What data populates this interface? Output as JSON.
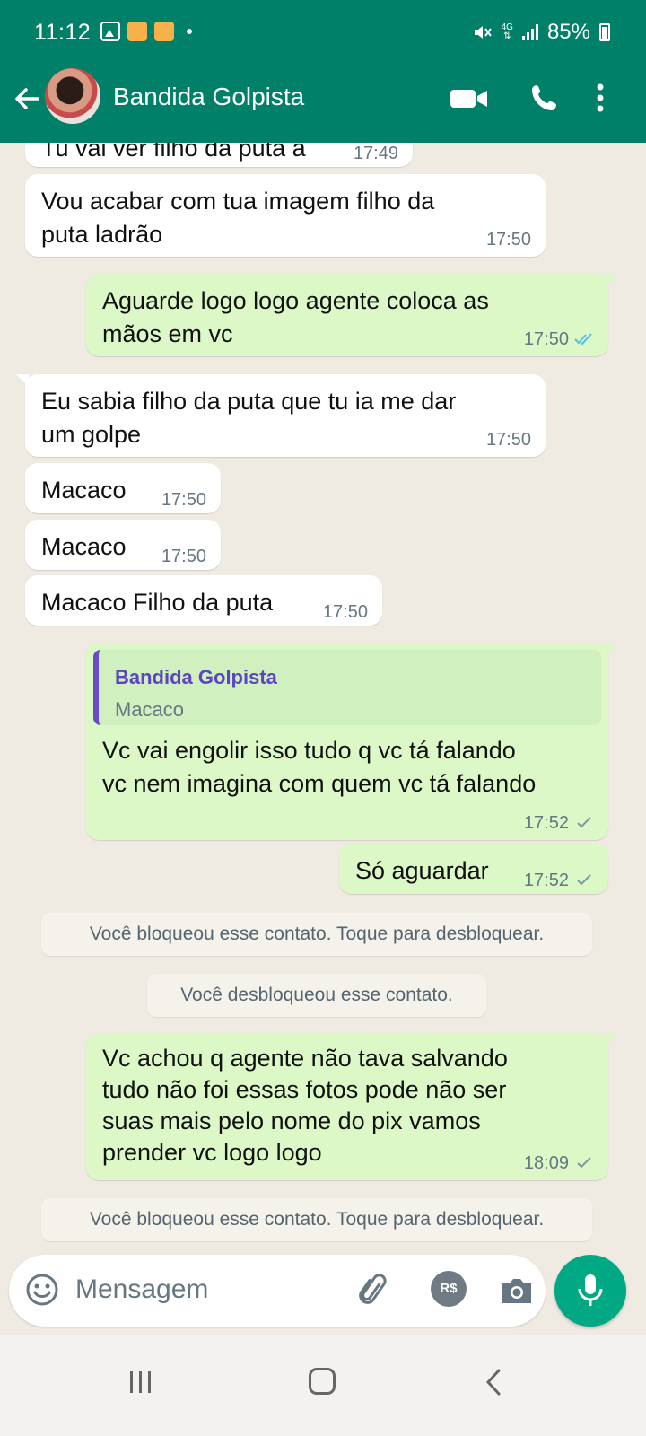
{
  "status_bar": {
    "time": "11:12",
    "network": "4G",
    "battery": "85%"
  },
  "header": {
    "contact_name": "Bandida Golpista"
  },
  "messages": [
    {
      "text": "Tu vai ver filho da puta a",
      "time": "17:49"
    },
    {
      "text": "Vou acabar com tua imagem filho da\nputa ladrão",
      "time": "17:50"
    },
    {
      "text": "Aguarde logo logo agente coloca as\nmãos em vc",
      "time": "17:50"
    },
    {
      "text": "Eu sabia filho da puta que tu ia me dar\num golpe",
      "time": "17:50"
    },
    {
      "text": "Macaco",
      "time": "17:50"
    },
    {
      "text": "Macaco",
      "time": "17:50"
    },
    {
      "text": "Macaco Filho da puta",
      "time": "17:50"
    },
    {
      "quote_name": "Bandida Golpista",
      "quote_text": "Macaco",
      "text": "Vc vai engolir isso tudo q vc tá falando\nvc nem imagina com quem vc tá falando",
      "time": "17:52"
    },
    {
      "text": "Só aguardar",
      "time": "17:52"
    },
    {
      "text": "Vc achou q agente não tava salvando\ntudo não foi essas fotos pode não ser\nsuas mais pelo nome do pix vamos\nprender vc logo logo",
      "time": "18:09"
    }
  ],
  "system_notices": [
    "Você bloqueou esse contato. Toque para desbloquear.",
    "Você desbloqueou esse contato.",
    "Você bloqueou esse contato. Toque para desbloquear."
  ],
  "composer": {
    "placeholder": "Mensagem",
    "pix_label": "R$"
  },
  "colors": {
    "header": "#008069",
    "outgoing_bubble": "#dcf8c6",
    "incoming_bubble": "#ffffff",
    "read_tick": "#53bdeb",
    "mic_button": "#00a884"
  },
  "icons": [
    "back-arrow-icon",
    "video-call-icon",
    "voice-call-icon",
    "more-options-icon",
    "emoji-icon",
    "attach-icon",
    "pix-icon",
    "camera-icon",
    "mic-icon"
  ]
}
